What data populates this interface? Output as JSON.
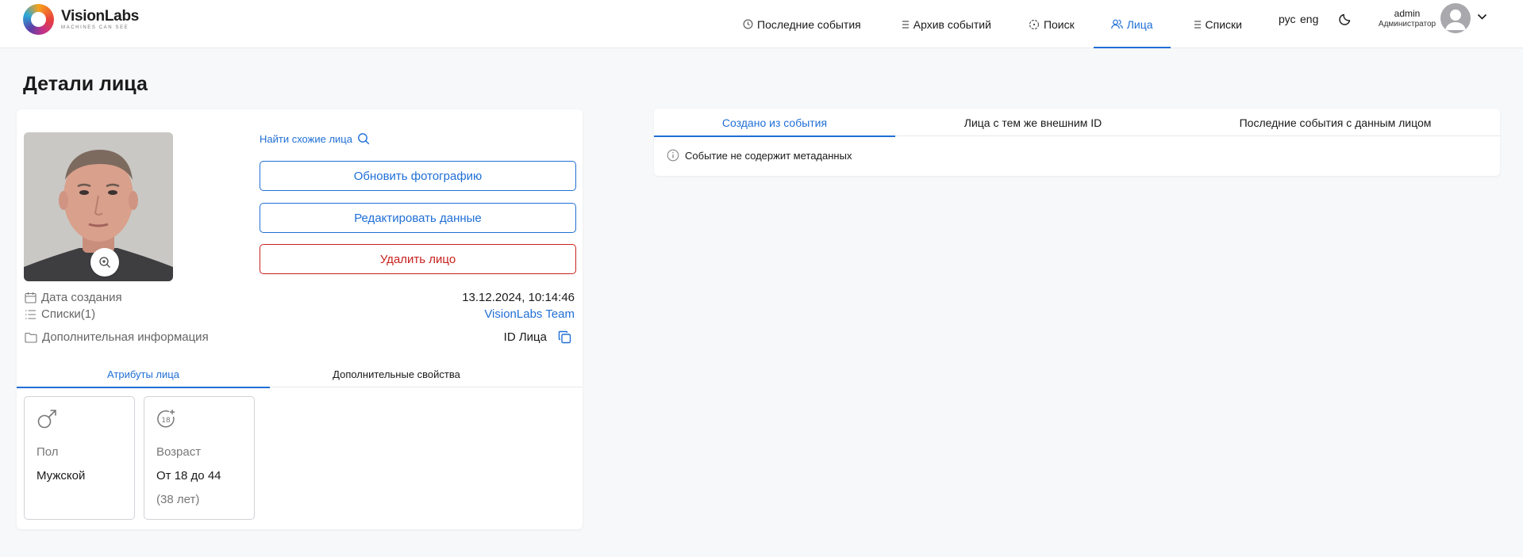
{
  "brand": {
    "name": "VisionLabs",
    "tagline": "MACHINES CAN SEE"
  },
  "nav": [
    {
      "label": "Последние события",
      "icon": "clock-icon"
    },
    {
      "label": "Архив событий",
      "icon": "list-icon"
    },
    {
      "label": "Поиск",
      "icon": "target-icon"
    },
    {
      "label": "Лица",
      "icon": "users-icon",
      "active": true
    },
    {
      "label": "Списки",
      "icon": "list-icon"
    }
  ],
  "lang": {
    "ru": "рус",
    "en": "eng"
  },
  "user": {
    "name": "admin",
    "role": "Администратор"
  },
  "page": {
    "title": "Детали лица"
  },
  "face": {
    "find_similar": "Найти схожие лица",
    "buttons": {
      "update_photo": "Обновить фотографию",
      "edit_data": "Редактировать данные",
      "delete_face": "Удалить лицо"
    },
    "info": {
      "created_label": "Дата создания",
      "created_value": "13.12.2024, 10:14:46",
      "lists_label": "Списки(1)",
      "lists_value": "VisionLabs Team",
      "extra_label": "Дополнительная информация",
      "id_label": "ID Лица"
    },
    "tabs": {
      "attributes": "Атрибуты лица",
      "extra_props": "Дополнительные свойства"
    },
    "attributes": {
      "gender_label": "Пол",
      "gender_value": "Мужской",
      "age_label": "Возраст",
      "age_value": "От 18 до 44",
      "age_exact": "(38 лет)"
    }
  },
  "right": {
    "tabs": [
      "Создано из события",
      "Лица с тем же внешним ID",
      "Последние события с данным лицом"
    ],
    "notice": "Событие не содержит метаданных"
  },
  "colors": {
    "accent": "#1f6fd6",
    "danger": "#c9211e"
  }
}
